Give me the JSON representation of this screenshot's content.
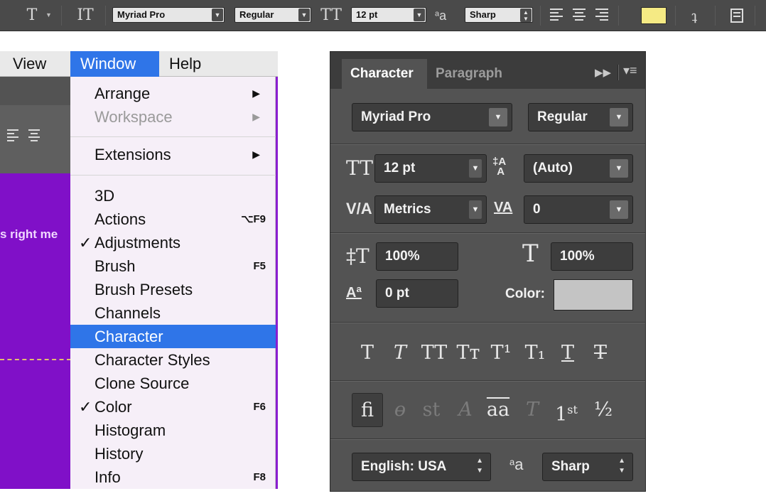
{
  "options_bar": {
    "font_family": "Myriad Pro",
    "font_style": "Regular",
    "font_size": "12 pt",
    "aa_label": "a",
    "aa_label_sub": "a",
    "antialias": "Sharp",
    "text_color": "#f5ea84",
    "icons": [
      "type-tool-icon",
      "text-orientation-icon",
      "font-size-icon",
      "align-left-icon",
      "align-center-icon",
      "align-right-icon",
      "warp-text-icon",
      "panels-icon"
    ]
  },
  "menu_bar": {
    "view": "View",
    "window": "Window",
    "help": "Help"
  },
  "app_canvas": {
    "overlay_text": "s right me",
    "accent": "#8010c8"
  },
  "window_menu": {
    "arrange": "Arrange",
    "workspace": "Workspace",
    "extensions": "Extensions",
    "items": [
      {
        "label": "3D",
        "check": "",
        "shortcut": ""
      },
      {
        "label": "Actions",
        "check": "",
        "shortcut": "⌥F9"
      },
      {
        "label": "Adjustments",
        "check": "✓",
        "shortcut": ""
      },
      {
        "label": "Brush",
        "check": "",
        "shortcut": "F5"
      },
      {
        "label": "Brush Presets",
        "check": "",
        "shortcut": ""
      },
      {
        "label": "Channels",
        "check": "",
        "shortcut": ""
      },
      {
        "label": "Character",
        "check": "",
        "shortcut": ""
      },
      {
        "label": "Character Styles",
        "check": "",
        "shortcut": ""
      },
      {
        "label": "Clone Source",
        "check": "",
        "shortcut": ""
      },
      {
        "label": "Color",
        "check": "✓",
        "shortcut": "F6"
      },
      {
        "label": "Histogram",
        "check": "",
        "shortcut": ""
      },
      {
        "label": "History",
        "check": "",
        "shortcut": ""
      },
      {
        "label": "Info",
        "check": "",
        "shortcut": "F8"
      }
    ],
    "submenu_arrow": "▶",
    "selected_color": "#2f75e8"
  },
  "character_panel": {
    "tab_character": "Character",
    "tab_paragraph": "Paragraph",
    "font_family": "Myriad Pro",
    "font_style": "Regular",
    "font_size": "12 pt",
    "leading": "(Auto)",
    "kerning": "Metrics",
    "tracking": "0",
    "vertical_scale": "100%",
    "horizontal_scale": "100%",
    "baseline_shift": "0 pt",
    "color_label": "Color:",
    "color_value": "#c4c4c4",
    "language": "English: USA",
    "aa_label": "a",
    "aa_label_sub": "a",
    "antialias": "Sharp",
    "type_style_buttons": [
      "T",
      "T",
      "TT",
      "Tт",
      "T¹",
      "T₁",
      "T",
      "T"
    ],
    "opentype_buttons": [
      "ﬁ",
      "ɵ",
      "st",
      "A",
      "aa",
      "T",
      "1st",
      "½"
    ],
    "ordinal_sup": "st"
  }
}
